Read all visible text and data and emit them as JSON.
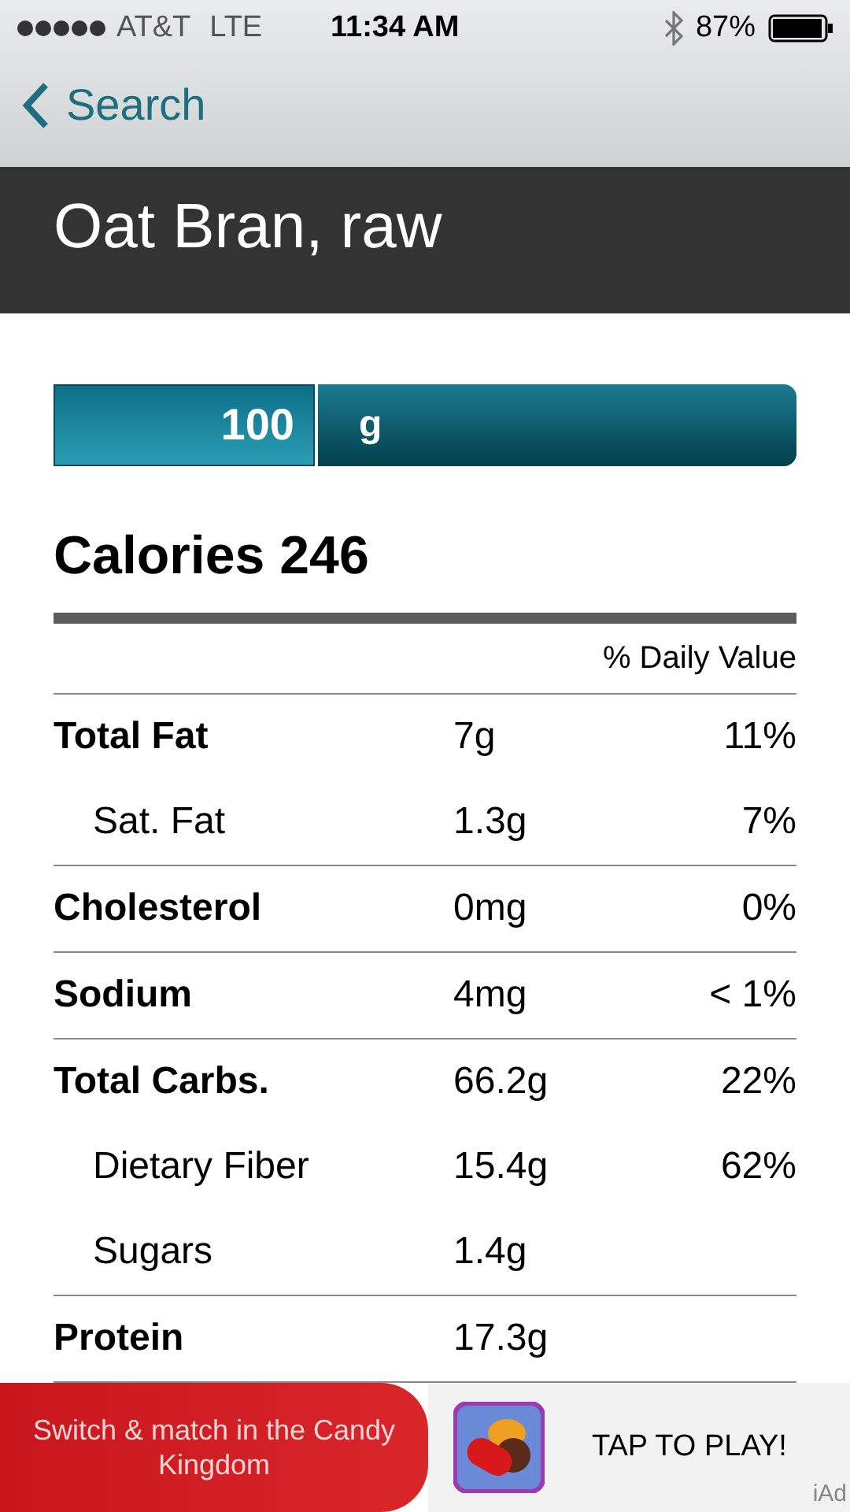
{
  "status_bar": {
    "carrier": "AT&T",
    "network": "LTE",
    "time": "11:34 AM",
    "battery": "87%"
  },
  "nav": {
    "back": "Search"
  },
  "title": "Oat Bran, raw",
  "serving": {
    "amount": "100",
    "unit": "g"
  },
  "calories": "Calories 246",
  "daily_value_header": "% Daily Value",
  "nutrients": [
    {
      "name": "Total Fat",
      "amount": "7g",
      "daily": "11%",
      "children": [
        {
          "name": "Sat. Fat",
          "amount": "1.3g",
          "daily": "7%"
        }
      ]
    },
    {
      "name": "Cholesterol",
      "amount": "0mg",
      "daily": "0%"
    },
    {
      "name": "Sodium",
      "amount": "4mg",
      "daily": "< 1%"
    },
    {
      "name": "Total Carbs.",
      "amount": "66.2g",
      "daily": "22%",
      "children": [
        {
          "name": "Dietary Fiber",
          "amount": "15.4g",
          "daily": "62%"
        },
        {
          "name": "Sugars",
          "amount": "1.4g"
        }
      ]
    },
    {
      "name": "Protein",
      "amount": "17.3g"
    }
  ],
  "ad": {
    "text": "Switch & match in the Candy Kingdom",
    "cta": "TAP TO PLAY!",
    "label": "iAd"
  }
}
